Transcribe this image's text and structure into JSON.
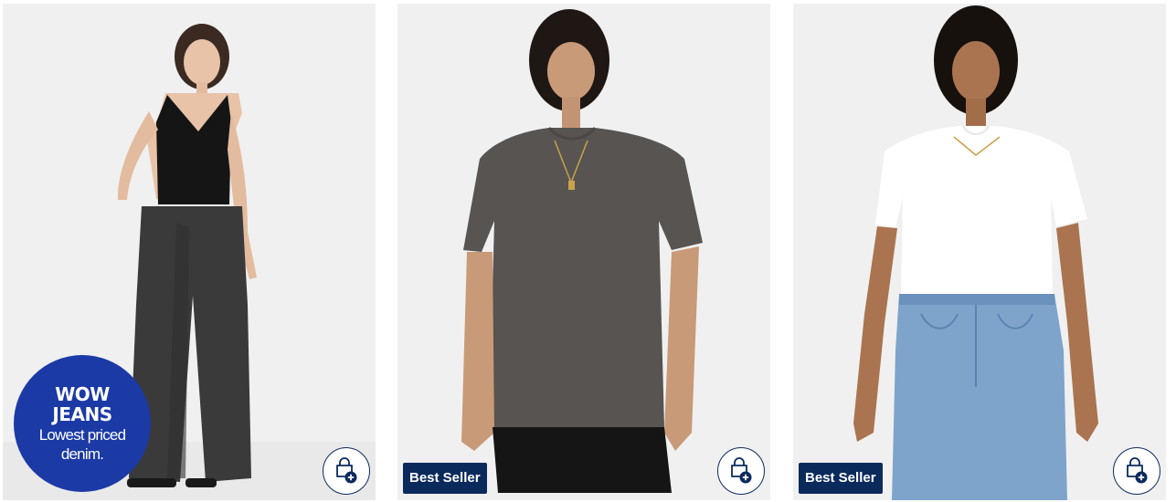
{
  "products": [
    {
      "badge": {
        "title_line1": "WOW",
        "title_line2": "JEANS",
        "sub_line1": "Lowest priced",
        "sub_line2": "denim."
      },
      "bag_icon": "shopping-bag-plus-icon"
    },
    {
      "tag": "Best Seller",
      "bag_icon": "shopping-bag-plus-icon"
    },
    {
      "tag": "Best Seller",
      "bag_icon": "shopping-bag-plus-icon"
    }
  ],
  "colors": {
    "card_bg": "#f1f1f1",
    "badge_blue": "#1b3aa6",
    "navy": "#0b2a5c"
  }
}
